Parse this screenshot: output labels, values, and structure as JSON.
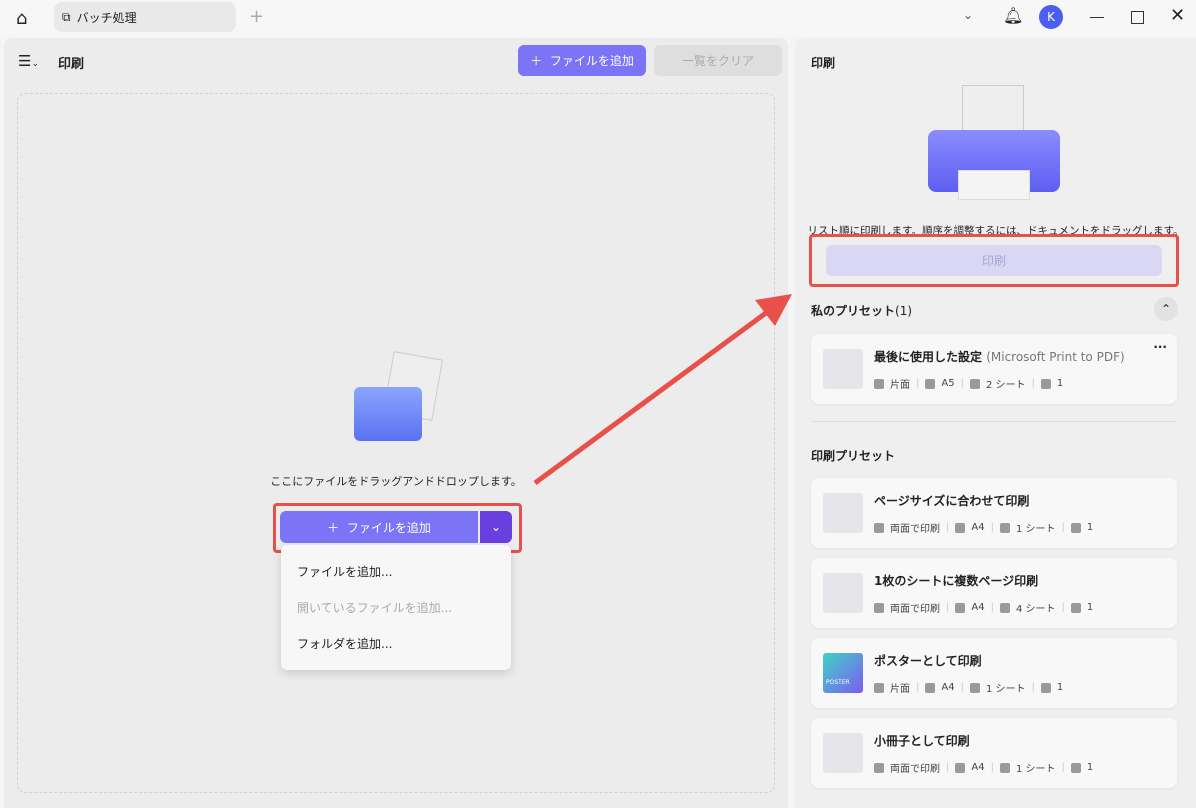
{
  "topbar": {
    "tab_label": "バッチ処理",
    "new_tab": "+",
    "avatar": "K"
  },
  "left": {
    "title": "印刷",
    "add_files": "ファイルを追加",
    "clear_list": "一覧をクリア",
    "drop_text": "ここにファイルをドラッグアンドドロップします。",
    "add_button": "ファイルを追加",
    "menu": [
      {
        "label": "ファイルを追加...",
        "disabled": false
      },
      {
        "label": "開いているファイルを追加...",
        "disabled": true
      },
      {
        "label": "フォルダを追加...",
        "disabled": false
      }
    ]
  },
  "right": {
    "title": "印刷",
    "hint": "リスト順に印刷します。順序を調整するには、ドキュメントをドラッグします。",
    "print_button": "印刷",
    "my_presets_title": "私のプリセット",
    "my_presets_count": "(1)",
    "my_preset": {
      "name": "最後に使用した設定",
      "printer": "(Microsoft Print to PDF)",
      "sides": "片面",
      "size": "A5",
      "sheets": "2 シート",
      "copies": "1",
      "more": "···"
    },
    "print_presets_title": "印刷プリセット",
    "presets": [
      {
        "name": "ページサイズに合わせて印刷",
        "sides": "両面で印刷",
        "size": "A4",
        "sheets": "1 シート",
        "copies": "1"
      },
      {
        "name": "1枚のシートに複数ページ印刷",
        "sides": "両面で印刷",
        "size": "A4",
        "sheets": "4 シート",
        "copies": "1"
      },
      {
        "name": "ポスターとして印刷",
        "sides": "片面",
        "size": "A4",
        "sheets": "1 シート",
        "copies": "1",
        "thumb_text": "POSTER"
      },
      {
        "name": "小冊子として印刷",
        "sides": "両面で印刷",
        "size": "A4",
        "sheets": "1 シート",
        "copies": "1"
      }
    ]
  },
  "colors": {
    "accent": "#7b74f7",
    "highlight": "#e8504a"
  }
}
